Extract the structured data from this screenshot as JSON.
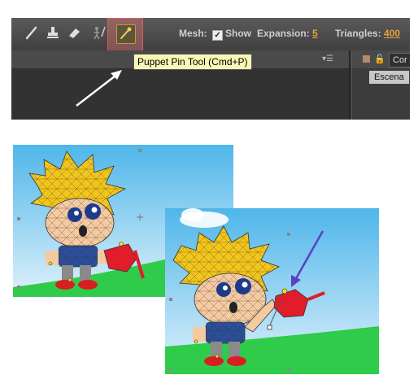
{
  "toolbar": {
    "tools": [
      {
        "name": "brush-tool-icon",
        "active": false
      },
      {
        "name": "clone-stamp-tool-icon",
        "active": false
      },
      {
        "name": "eraser-tool-icon",
        "active": false
      },
      {
        "name": "roto-brush-tool-icon",
        "active": false
      },
      {
        "name": "puppet-pin-tool-icon",
        "active": true
      }
    ],
    "mesh_label": "Mesh:",
    "show_label": "Show",
    "show_checked": true,
    "expansion_label": "Expansion:",
    "expansion_value": "5",
    "triangles_label": "Triangles:",
    "triangles_value": "400"
  },
  "tooltip": {
    "text": "Puppet Pin Tool (Cmd+P)"
  },
  "panel": {
    "comp_tab_label": "Cor",
    "scene_tab_label": "Escena"
  },
  "colors": {
    "highlight": "#ff7878",
    "tooltip_bg": "#f9f7b5",
    "accent_value": "#e6a23c",
    "annotation_arrow": "#5b3fbf"
  }
}
